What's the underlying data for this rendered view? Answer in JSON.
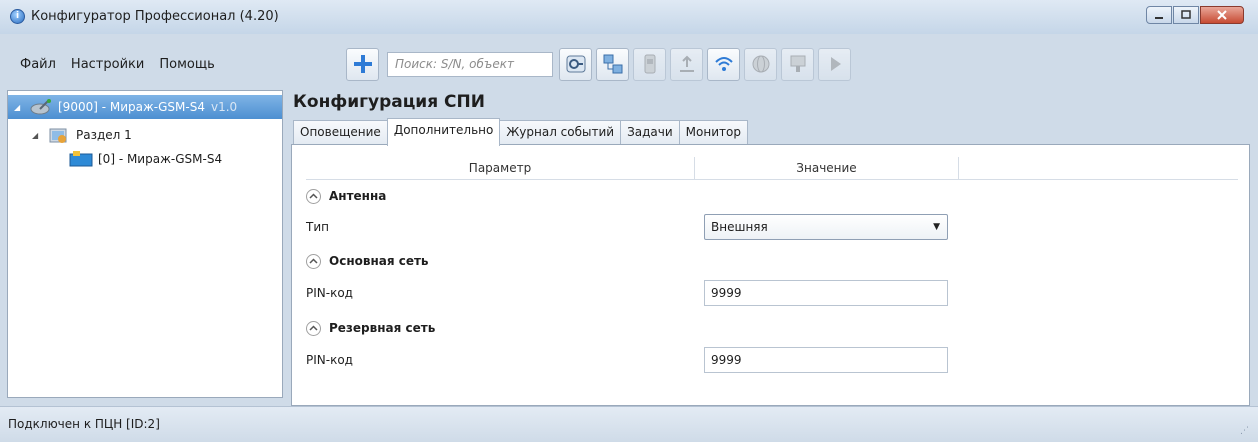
{
  "window": {
    "title": "Конфигуратор Профессионал (4.20)",
    "app_icon_glyph": "i"
  },
  "menu": {
    "items": [
      "Файл",
      "Настройки",
      "Помощь"
    ]
  },
  "toolbar": {
    "search_placeholder": "Поиск: S/N, объект",
    "buttons": [
      "add-icon",
      "connect-icon",
      "network-icon",
      "device-icon",
      "upload-icon",
      "wifi-icon",
      "globe-icon",
      "monitor-icon",
      "play-icon"
    ]
  },
  "tree": {
    "root": {
      "label": "[9000] - Мираж-GSM-S4",
      "version": "v1.0"
    },
    "section": {
      "label": "Раздел 1"
    },
    "device": {
      "label": "[0] - Мираж-GSM-S4"
    }
  },
  "main": {
    "title": "Конфигурация СПИ",
    "tabs": [
      "Оповещение",
      "Дополнительно",
      "Журнал событий",
      "Задачи",
      "Монитор"
    ],
    "active_tab": "Дополнительно",
    "columns": {
      "param": "Параметр",
      "value": "Значение"
    },
    "groups": [
      {
        "title": "Антенна",
        "param": "Тип",
        "value": "Внешняя",
        "control": "select"
      },
      {
        "title": "Основная сеть",
        "param": "PIN-код",
        "value": "9999",
        "control": "input"
      },
      {
        "title": "Резервная сеть",
        "param": "PIN-код",
        "value": "9999",
        "control": "input"
      }
    ]
  },
  "status": {
    "text": "Подключен к ПЦН [ID:2]"
  },
  "colors": {
    "chrome": "#cfdbe8",
    "selection": "#4d8fd1",
    "close_button": "#c74b33"
  }
}
